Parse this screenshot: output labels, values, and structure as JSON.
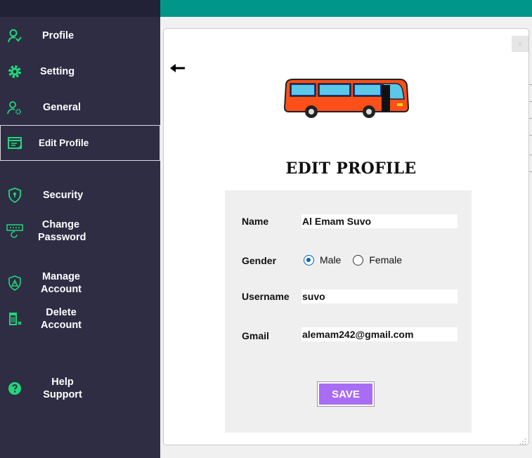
{
  "sidebar": {
    "items": [
      {
        "label": "Profile",
        "icon": "user-icon"
      },
      {
        "label": "Setting",
        "icon": "gear-icon"
      },
      {
        "label": "General",
        "icon": "user-gear-icon"
      },
      {
        "label": "Edit Profile",
        "icon": "edit-form-icon"
      },
      {
        "label": "Security",
        "icon": "shield-icon"
      },
      {
        "label": "Change\nPassword",
        "icon": "password-icon"
      },
      {
        "label": "Manage\nAccount",
        "icon": "shield-warning-icon"
      },
      {
        "label": "Delete\nAccount",
        "icon": "trash-icon"
      },
      {
        "label": "Help\nSupport",
        "icon": "help-icon"
      }
    ],
    "active_index": 3
  },
  "dialog": {
    "title": "EDIT PROFILE",
    "close_label": "x",
    "fields": {
      "name_label": "Name",
      "name_value": "Al Emam Suvo",
      "gender_label": "Gender",
      "gender_options": [
        "Male",
        "Female"
      ],
      "gender_selected": "Male",
      "username_label": "Username",
      "username_value": "suvo",
      "gmail_label": "Gmail",
      "gmail_value": "alemam242@gmail.com"
    },
    "save_label": "SAVE"
  },
  "colors": {
    "sidebar_bg": "#2e2d44",
    "accent_green": "#22d67a",
    "topbar_teal": "#00968a",
    "save_purple": "#a86cf5",
    "radio_blue": "#0063b1"
  }
}
